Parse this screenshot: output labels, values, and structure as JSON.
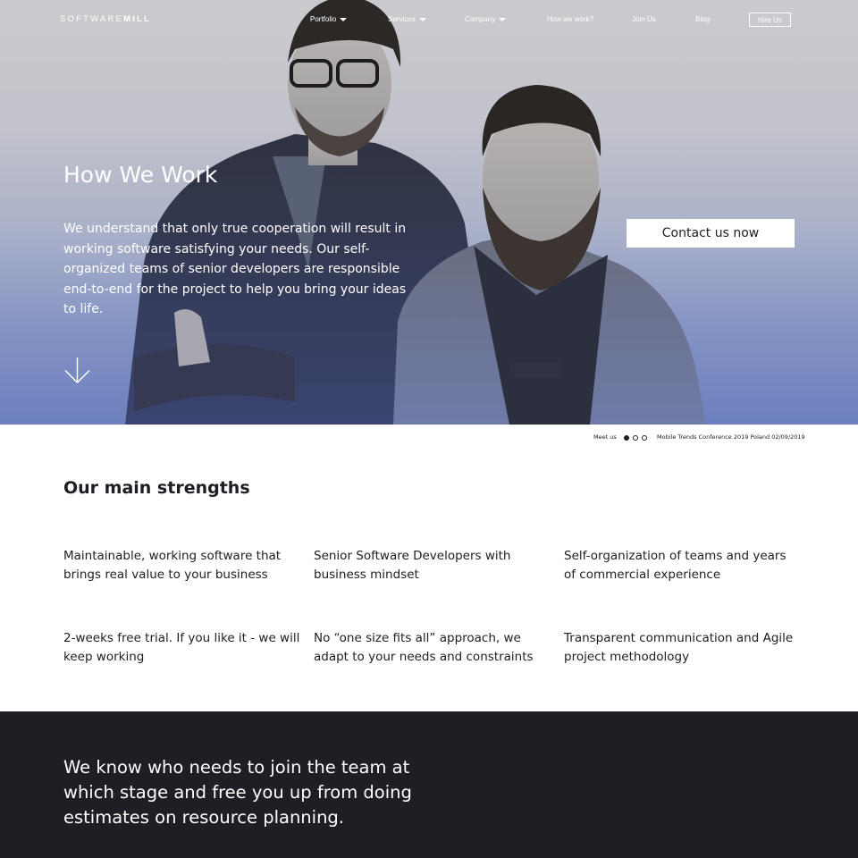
{
  "nav": {
    "logo_light": "SOFTWARE",
    "logo_bold": "MILL",
    "items": [
      {
        "label": "Portfolio",
        "dropdown": true
      },
      {
        "label": "Services",
        "dropdown": true
      },
      {
        "label": "Company",
        "dropdown": true
      },
      {
        "label": "How we work?",
        "dropdown": false
      },
      {
        "label": "Join Us",
        "dropdown": false
      },
      {
        "label": "Blog",
        "dropdown": false
      }
    ],
    "hire_label": "Hire Us"
  },
  "hero": {
    "title": "How We Work",
    "text": "We understand that only true cooperation will result in working software satisfying your needs. Our self-organized teams of senior developers are responsible end-to-end for the project to help you bring your ideas to life.",
    "cta_label": "Contact us now",
    "arrow_icon": "arrow-down-icon"
  },
  "meetus": {
    "label": "Meet us",
    "event": "Mobile Trends Conference 2019 Poland 02/09/2019",
    "dots": 3,
    "active_dot": 0
  },
  "strengths": {
    "title": "Our main strengths",
    "items": [
      "Maintainable, working software that brings real value to your business",
      "Senior Software Developers with business mindset",
      "Self-organization of teams and years of commercial experience",
      "2-weeks free trial. If you like it - we will keep working",
      "No “one size fits all” approach, we adapt to your needs and constraints",
      "Transparent communication and Agile project methodology"
    ]
  },
  "team": {
    "text": "We know who needs to join the team at which stage and free you up from doing estimates on resource planning."
  },
  "colors": {
    "dark_bg": "#1e1e25",
    "hero_blue": "#6d80bf",
    "text": "#1d1d24"
  }
}
